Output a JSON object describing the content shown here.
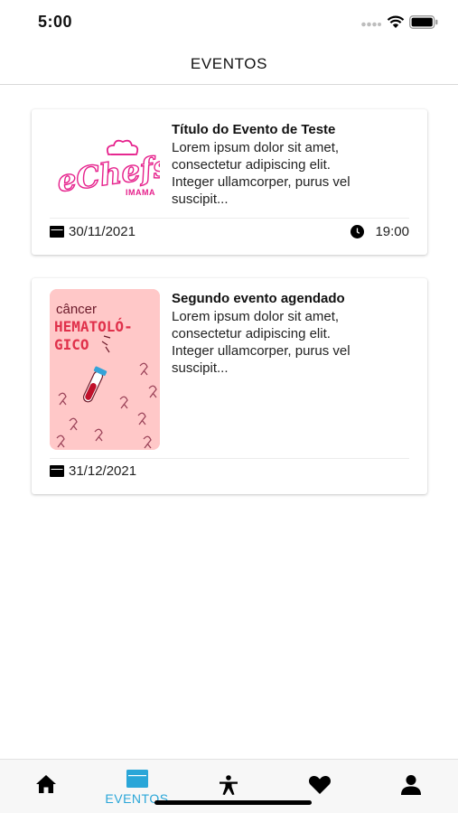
{
  "status_bar": {
    "time": "5:00"
  },
  "header": {
    "title": "EVENTOS"
  },
  "events": [
    {
      "title": "Título do Evento de Teste",
      "description": "Lorem ipsum dolor sit amet,\nconsectetur adipiscing elit.\nInteger ullamcorper, purus vel\nsuscipit...",
      "date": "30/11/2021",
      "time": "19:00",
      "image": {
        "logo_text": "eChefs",
        "logo_subtext": "IMAMA",
        "color": "#e6218c"
      }
    },
    {
      "title": "Segundo evento agendado",
      "description": "Lorem ipsum dolor sit amet,\nconsectetur adipiscing elit.\nInteger ullamcorper, purus vel\nsuscipit...",
      "date": "31/12/2021",
      "image": {
        "line1": "câncer",
        "line2": "HEMATOLÓ-",
        "line3": "GICO",
        "bg_color": "#ffc8c8",
        "accent_color": "#e0314b"
      }
    }
  ],
  "tab_bar": {
    "active_label": "EVENTOS",
    "active_color": "#2aa6d8",
    "items": [
      {
        "icon": "home-icon"
      },
      {
        "icon": "calendar-icon"
      },
      {
        "icon": "accessibility-icon"
      },
      {
        "icon": "heart-icon"
      },
      {
        "icon": "person-icon"
      }
    ]
  }
}
